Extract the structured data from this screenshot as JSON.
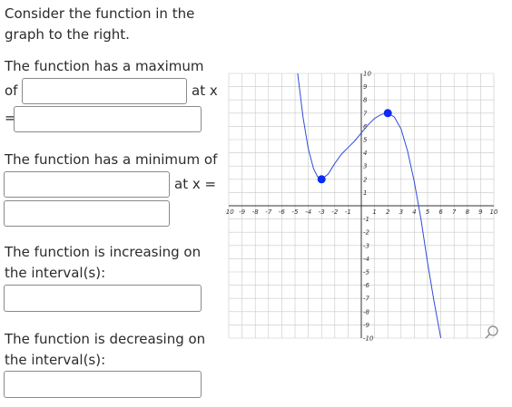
{
  "question": {
    "intro_line1": "Consider the function in the",
    "intro_line2": "graph to the right.",
    "max_line1": "The function has a maximum",
    "max_of": "of",
    "max_at": "at x",
    "max_eq": "=",
    "min_line": "The function has a minimum of",
    "min_at": "at x =",
    "inc_line1": "The function is increasing on",
    "inc_line2": "the interval(s):",
    "dec_line1": "The function is decreasing on",
    "dec_line2": "the interval(s):"
  },
  "inputs": {
    "max_value": "",
    "max_x": "",
    "min_value": "",
    "min_x": "",
    "increasing": "",
    "decreasing": ""
  },
  "graph": {
    "x_ticks": [
      "-10",
      "-9",
      "-8",
      "-7",
      "-6",
      "-5",
      "-4",
      "-3",
      "-2",
      "-1",
      "1",
      "2",
      "3",
      "4",
      "5",
      "6",
      "7",
      "8",
      "9",
      "10"
    ],
    "y_ticks": [
      "10",
      "9",
      "8",
      "7",
      "6",
      "5",
      "4",
      "3",
      "2",
      "1",
      "-1",
      "-2",
      "-3",
      "-4",
      "-5",
      "-6",
      "-7",
      "-8",
      "-9",
      "-10"
    ],
    "magnifier_icon": "search-icon"
  },
  "chart_data": {
    "type": "line",
    "xlim": [
      -10,
      10
    ],
    "ylim": [
      -10,
      10
    ],
    "grid": true,
    "color": "#2f4bd6",
    "x": [
      -4.8,
      -4.4,
      -4.0,
      -3.6,
      -3.3,
      -3.0,
      -2.5,
      -2.0,
      -1.5,
      -1.0,
      -0.5,
      0.0,
      0.5,
      1.0,
      1.5,
      2.0,
      2.5,
      3.0,
      3.5,
      4.0,
      4.5,
      5.0,
      5.5,
      6.0
    ],
    "y": [
      10,
      6.7,
      4.3,
      2.8,
      2.2,
      2.0,
      2.4,
      3.2,
      3.9,
      4.4,
      4.9,
      5.5,
      6.1,
      6.6,
      6.9,
      7.0,
      6.7,
      5.8,
      4.1,
      1.8,
      -1.0,
      -4.3,
      -7.3,
      -10
    ],
    "points": [
      {
        "x": -3,
        "y": 2
      },
      {
        "x": 2,
        "y": 7
      }
    ]
  }
}
